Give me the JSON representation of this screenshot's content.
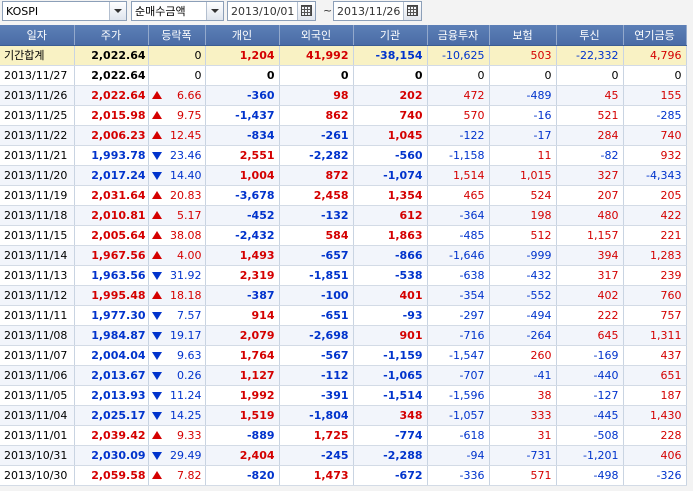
{
  "toolbar": {
    "market": "KOSPI",
    "mode": "순매수금액",
    "start_date": "2013/10/01",
    "range_sep": "~",
    "end_date": "2013/11/26"
  },
  "colors": {
    "up": "#d40000",
    "down": "#0033cc",
    "header_bg": "#5474ae",
    "sum_bg": "#f9f2c4"
  },
  "table": {
    "columns": [
      "일자",
      "주가",
      "등락폭",
      "개인",
      "외국인",
      "기관",
      "금융투자",
      "보험",
      "투신",
      "연기금등"
    ],
    "rows": [
      {
        "date": "기간합계",
        "index": "2,022.64",
        "dir": "none",
        "change": "0",
        "indiv": "1,204",
        "foreign": "41,992",
        "inst": "-38,154",
        "fin": "-10,625",
        "ins": "503",
        "trust": "-22,332",
        "pension": "4,796",
        "sum": true
      },
      {
        "date": "2013/11/27",
        "index": "2,022.64",
        "dir": "none",
        "change": "0",
        "indiv": "0",
        "foreign": "0",
        "inst": "0",
        "fin": "0",
        "ins": "0",
        "trust": "0",
        "pension": "0"
      },
      {
        "date": "2013/11/26",
        "index": "2,022.64",
        "dir": "up",
        "change": "6.66",
        "indiv": "-360",
        "foreign": "98",
        "inst": "202",
        "fin": "472",
        "ins": "-489",
        "trust": "45",
        "pension": "155"
      },
      {
        "date": "2013/11/25",
        "index": "2,015.98",
        "dir": "up",
        "change": "9.75",
        "indiv": "-1,437",
        "foreign": "862",
        "inst": "740",
        "fin": "570",
        "ins": "-16",
        "trust": "521",
        "pension": "-285"
      },
      {
        "date": "2013/11/22",
        "index": "2,006.23",
        "dir": "up",
        "change": "12.45",
        "indiv": "-834",
        "foreign": "-261",
        "inst": "1,045",
        "fin": "-122",
        "ins": "-17",
        "trust": "284",
        "pension": "740"
      },
      {
        "date": "2013/11/21",
        "index": "1,993.78",
        "dir": "down",
        "change": "23.46",
        "indiv": "2,551",
        "foreign": "-2,282",
        "inst": "-560",
        "fin": "-1,158",
        "ins": "11",
        "trust": "-82",
        "pension": "932"
      },
      {
        "date": "2013/11/20",
        "index": "2,017.24",
        "dir": "down",
        "change": "14.40",
        "indiv": "1,004",
        "foreign": "872",
        "inst": "-1,074",
        "fin": "1,514",
        "ins": "1,015",
        "trust": "327",
        "pension": "-4,343"
      },
      {
        "date": "2013/11/19",
        "index": "2,031.64",
        "dir": "up",
        "change": "20.83",
        "indiv": "-3,678",
        "foreign": "2,458",
        "inst": "1,354",
        "fin": "465",
        "ins": "524",
        "trust": "207",
        "pension": "205"
      },
      {
        "date": "2013/11/18",
        "index": "2,010.81",
        "dir": "up",
        "change": "5.17",
        "indiv": "-452",
        "foreign": "-132",
        "inst": "612",
        "fin": "-364",
        "ins": "198",
        "trust": "480",
        "pension": "422"
      },
      {
        "date": "2013/11/15",
        "index": "2,005.64",
        "dir": "up",
        "change": "38.08",
        "indiv": "-2,432",
        "foreign": "584",
        "inst": "1,863",
        "fin": "-485",
        "ins": "512",
        "trust": "1,157",
        "pension": "221"
      },
      {
        "date": "2013/11/14",
        "index": "1,967.56",
        "dir": "up",
        "change": "4.00",
        "indiv": "1,493",
        "foreign": "-657",
        "inst": "-866",
        "fin": "-1,646",
        "ins": "-999",
        "trust": "394",
        "pension": "1,283"
      },
      {
        "date": "2013/11/13",
        "index": "1,963.56",
        "dir": "down",
        "change": "31.92",
        "indiv": "2,319",
        "foreign": "-1,851",
        "inst": "-538",
        "fin": "-638",
        "ins": "-432",
        "trust": "317",
        "pension": "239"
      },
      {
        "date": "2013/11/12",
        "index": "1,995.48",
        "dir": "up",
        "change": "18.18",
        "indiv": "-387",
        "foreign": "-100",
        "inst": "401",
        "fin": "-354",
        "ins": "-552",
        "trust": "402",
        "pension": "760"
      },
      {
        "date": "2013/11/11",
        "index": "1,977.30",
        "dir": "down",
        "change": "7.57",
        "indiv": "914",
        "foreign": "-651",
        "inst": "-93",
        "fin": "-297",
        "ins": "-494",
        "trust": "222",
        "pension": "757"
      },
      {
        "date": "2013/11/08",
        "index": "1,984.87",
        "dir": "down",
        "change": "19.17",
        "indiv": "2,079",
        "foreign": "-2,698",
        "inst": "901",
        "fin": "-716",
        "ins": "-264",
        "trust": "645",
        "pension": "1,311"
      },
      {
        "date": "2013/11/07",
        "index": "2,004.04",
        "dir": "down",
        "change": "9.63",
        "indiv": "1,764",
        "foreign": "-567",
        "inst": "-1,159",
        "fin": "-1,547",
        "ins": "260",
        "trust": "-169",
        "pension": "437"
      },
      {
        "date": "2013/11/06",
        "index": "2,013.67",
        "dir": "down",
        "change": "0.26",
        "indiv": "1,127",
        "foreign": "-112",
        "inst": "-1,065",
        "fin": "-707",
        "ins": "-41",
        "trust": "-440",
        "pension": "651"
      },
      {
        "date": "2013/11/05",
        "index": "2,013.93",
        "dir": "down",
        "change": "11.24",
        "indiv": "1,992",
        "foreign": "-391",
        "inst": "-1,514",
        "fin": "-1,596",
        "ins": "38",
        "trust": "-127",
        "pension": "187"
      },
      {
        "date": "2013/11/04",
        "index": "2,025.17",
        "dir": "down",
        "change": "14.25",
        "indiv": "1,519",
        "foreign": "-1,804",
        "inst": "348",
        "fin": "-1,057",
        "ins": "333",
        "trust": "-445",
        "pension": "1,430"
      },
      {
        "date": "2013/11/01",
        "index": "2,039.42",
        "dir": "up",
        "change": "9.33",
        "indiv": "-889",
        "foreign": "1,725",
        "inst": "-774",
        "fin": "-618",
        "ins": "31",
        "trust": "-508",
        "pension": "228"
      },
      {
        "date": "2013/10/31",
        "index": "2,030.09",
        "dir": "down",
        "change": "29.49",
        "indiv": "2,404",
        "foreign": "-245",
        "inst": "-2,288",
        "fin": "-94",
        "ins": "-731",
        "trust": "-1,201",
        "pension": "406"
      },
      {
        "date": "2013/10/30",
        "index": "2,059.58",
        "dir": "up",
        "change": "7.82",
        "indiv": "-820",
        "foreign": "1,473",
        "inst": "-672",
        "fin": "-336",
        "ins": "571",
        "trust": "-498",
        "pension": "-326"
      }
    ]
  }
}
